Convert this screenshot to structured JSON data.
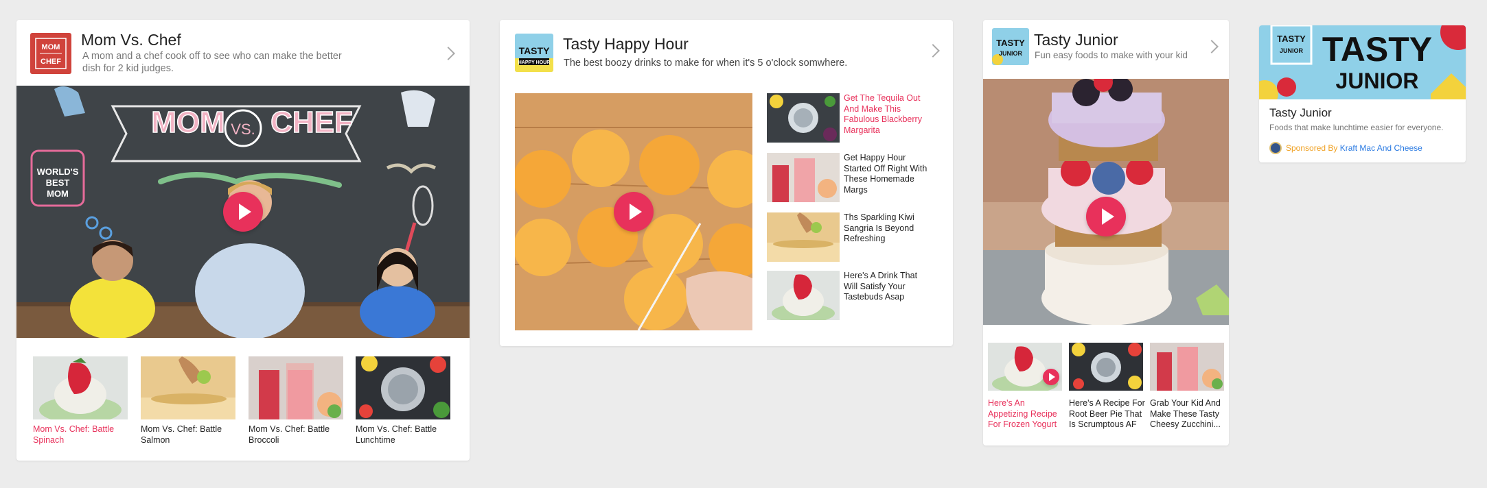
{
  "cards": {
    "mom": {
      "title": "Mom Vs. Chef",
      "description": "A mom and a chef cook off to see who can make the better dish for 2 kid judges.",
      "logo_text_top": "MOM",
      "logo_text_bottom": "CHEF",
      "hero_banner_left": "MOM",
      "hero_banner_vs": "VS.",
      "hero_banner_right": "CHEF",
      "hero_badge": "WORLD'S BEST MOM",
      "videos": [
        {
          "label": "Mom Vs. Chef: Battle Spinach",
          "active": true
        },
        {
          "label": "Mom Vs. Chef: Battle Salmon",
          "active": false
        },
        {
          "label": "Mom Vs. Chef: Battle Broccoli",
          "active": false
        },
        {
          "label": "Mom Vs. Chef: Battle Lunchtime",
          "active": false
        }
      ]
    },
    "happy": {
      "title": "Tasty Happy Hour",
      "description": "The best boozy drinks to make for when it's 5 o'clock somwhere.",
      "logo_text_top": "TASTY",
      "logo_text_bottom": "HAPPY HOUR",
      "videos": [
        {
          "label": "Get The Tequila Out And Make This Fabulous Blackberry Margarita",
          "active": true
        },
        {
          "label": "Get Happy Hour Started Off Right With These Homemade Margs",
          "active": false
        },
        {
          "label": "Ths Sparkling Kiwi Sangria Is Beyond Refreshing",
          "active": false
        },
        {
          "label": "Here's A Drink That Will Satisfy Your Tastebuds Asap",
          "active": false
        }
      ]
    },
    "junior": {
      "title": "Tasty Junior",
      "description": "Fun easy foods to make with your kid",
      "logo_text_top": "TASTY",
      "logo_text_bottom": "JUNIOR",
      "videos": [
        {
          "label": "Here's An Appetizing Recipe For Frozen Yogurt",
          "active": true
        },
        {
          "label": "Here's A Recipe For Root Beer Pie That Is Scrumptous AF",
          "active": false
        },
        {
          "label": "Grab Your Kid And Make These Tasty Cheesy Zucchini...",
          "active": false
        }
      ]
    },
    "promo": {
      "title": "Tasty Junior",
      "description": "Foods that make lunchtime easier for everyone.",
      "banner_top": "TASTY",
      "banner_bottom": "JUNIOR",
      "sponsored_label": "Sponsored By",
      "sponsor": "Kraft Mac And Cheese"
    }
  },
  "colors": {
    "accent": "#e8315b",
    "link": "#2a7ae2",
    "sponsor_label": "#f0a020",
    "background": "#ececec"
  }
}
